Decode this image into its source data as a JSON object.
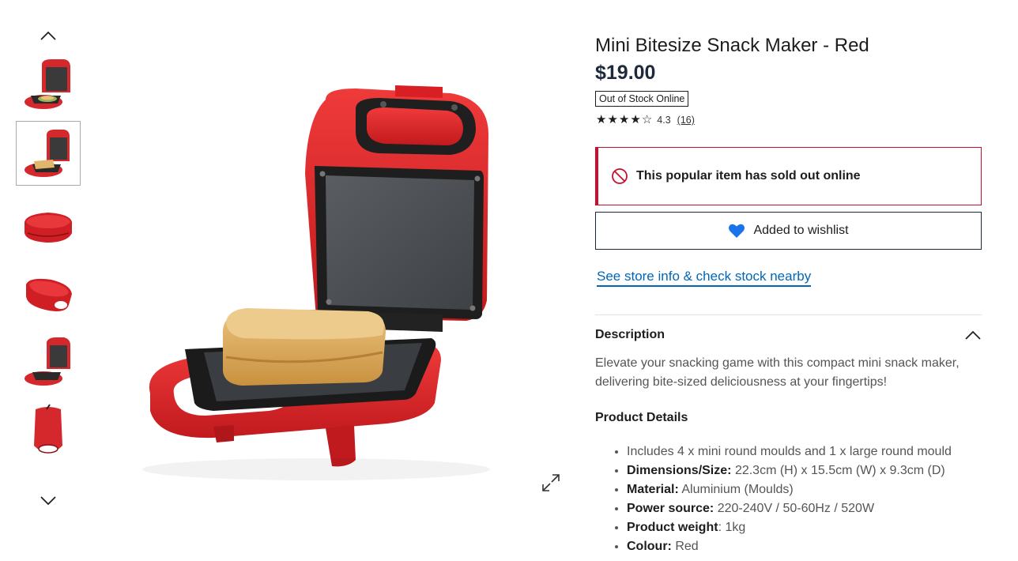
{
  "product": {
    "title": "Mini Bitesize Snack Maker - Red",
    "price": "$19.00",
    "stock_badge": "Out of Stock Online",
    "rating": {
      "score": "4.3",
      "stars_out_of_5": 4.3,
      "review_count": "(16)"
    }
  },
  "alert": {
    "icon": "no-entry-icon",
    "text": "This popular item has sold out online"
  },
  "wishlist": {
    "icon": "heart-icon",
    "label": "Added to wishlist"
  },
  "store_link": "See store info & check stock nearby",
  "description": {
    "header": "Description",
    "body": "Elevate your snacking game with this compact mini snack maker, delivering bite-sized deliciousness at your fingertips!",
    "details_title": "Product Details",
    "details": [
      {
        "label": "",
        "value": "Includes 4 x mini round moulds and 1 x large round mould"
      },
      {
        "label": "Dimensions/Size:",
        "value": "22.3cm (H) x 15.5cm (W) x 9.3cm (D)"
      },
      {
        "label": "Material:",
        "value": "Aluminium (Moulds)"
      },
      {
        "label": "Power source:",
        "value": "220-240V / 50-60Hz / 520W"
      },
      {
        "label": "Product weight",
        "value": ": 1kg"
      },
      {
        "label": "Colour:",
        "value": "Red"
      }
    ]
  },
  "gallery": {
    "selected_index": 1,
    "thumbnail_count": 6
  },
  "colors": {
    "brand_red": "#c8102e",
    "link_blue": "#0067b8",
    "heart_blue": "#1a73e8"
  }
}
